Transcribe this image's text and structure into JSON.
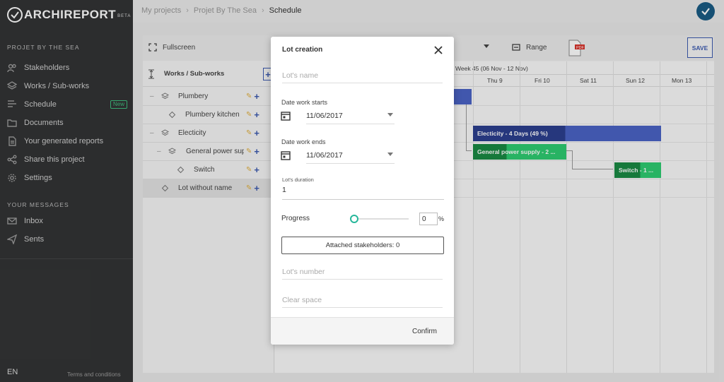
{
  "app": {
    "logo_text": "ARCHIREPORT",
    "logo_beta": "BETA"
  },
  "sidebar": {
    "project_section": "PROJET BY THE SEA",
    "items": [
      {
        "label": "Stakeholders",
        "icon": "users-icon"
      },
      {
        "label": "Works / Sub-works",
        "icon": "layers-icon"
      },
      {
        "label": "Schedule",
        "icon": "schedule-icon",
        "badge": "New"
      },
      {
        "label": "Documents",
        "icon": "folder-icon"
      },
      {
        "label": "Your generated reports",
        "icon": "report-icon"
      },
      {
        "label": "Share this project",
        "icon": "share-icon"
      },
      {
        "label": "Settings",
        "icon": "gear-icon"
      }
    ],
    "messages_section": "YOUR MESSAGES",
    "message_items": [
      {
        "label": "Inbox",
        "icon": "mail-icon"
      },
      {
        "label": "Sents",
        "icon": "send-icon"
      }
    ],
    "lang": "EN",
    "terms": "Terms and conditions"
  },
  "breadcrumb": [
    "My projects",
    "Projet By The Sea",
    "Schedule"
  ],
  "toolbar": {
    "fullscreen": "Fullscreen",
    "range": "Range",
    "save": "SAVE",
    "pdf_label": "PDF"
  },
  "tree": {
    "header": "Works / Sub-works",
    "rows": [
      {
        "label": "Plumbery",
        "level": 0,
        "collapsible": true
      },
      {
        "label": "Plumbery kitchen",
        "level": 1,
        "collapsible": false
      },
      {
        "label": "Electicity",
        "level": 0,
        "collapsible": true
      },
      {
        "label": "General power sup",
        "level": 1,
        "collapsible": true
      },
      {
        "label": "Switch",
        "level": 2,
        "collapsible": false
      },
      {
        "label": "Lot without name",
        "level": 0,
        "collapsible": false
      }
    ]
  },
  "gantt": {
    "week": "Week 45 (06 Nov - 12 Nov)",
    "days": [
      "Thu 9",
      "Fri 10",
      "Sat 11",
      "Sun 12",
      "Mon 13"
    ],
    "bars": [
      {
        "label": "Electicity - 4 Days (49 %)",
        "color": "#4a63c5",
        "progress_color": "#2c3f8f",
        "progress": 0.49
      },
      {
        "label": "General power supply - 2 ...",
        "color": "#2ecc71",
        "progress_color": "#1a8a44",
        "progress": 0.36
      },
      {
        "label": "Switch - 1 ...",
        "color": "#2ecc71",
        "progress_color": "#1a8a44",
        "progress": 0.55
      }
    ]
  },
  "modal": {
    "title": "Lot creation",
    "name_placeholder": "Lot's name",
    "start_caption": "Date work starts",
    "start_value": "11/06/2017",
    "end_caption": "Date work ends",
    "end_value": "11/06/2017",
    "duration_caption": "Lot's duration",
    "duration_value": "1",
    "progress_label": "Progress",
    "progress_value": "0",
    "progress_unit": "%",
    "stakeholders_button": "Attached stakeholders: 0",
    "number_placeholder": "Lot's number",
    "clear_space_placeholder": "Clear space",
    "confirm": "Confirm"
  }
}
